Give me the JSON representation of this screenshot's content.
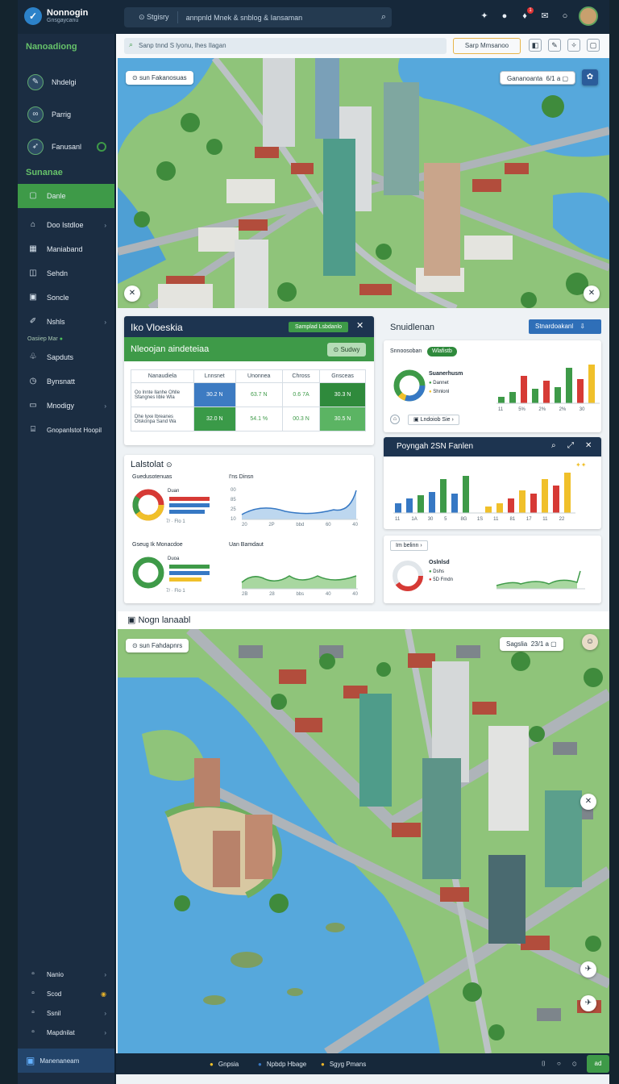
{
  "app": {
    "name": "Nonnogin",
    "subtitle": "Gnsgaycanu"
  },
  "search": {
    "scope": "Stgisry",
    "query": "annpnld Mnek & snblog & Iansaman"
  },
  "sidebar": {
    "section1": "Nanoadiong",
    "top_items": [
      {
        "label": "Nhdelgi",
        "icon": "leaf-icon"
      },
      {
        "label": "Parrig",
        "icon": "link-icon"
      },
      {
        "label": "Fanusanl",
        "icon": "plane-icon"
      }
    ],
    "section2": "Sunanae",
    "items": [
      {
        "label": "Danle",
        "icon": "square-icon"
      },
      {
        "label": "Doo Istdloe",
        "icon": "pin-icon"
      },
      {
        "label": "Maniaband",
        "icon": "grid-icon"
      },
      {
        "label": "Sehdn",
        "icon": "box-icon"
      },
      {
        "label": "Soncle",
        "icon": "frame-icon"
      },
      {
        "label": "Nshls",
        "icon": "pen-icon"
      }
    ],
    "status": "Oasiiep Mar",
    "items2": [
      {
        "label": "Sapduts",
        "icon": "bag-icon"
      },
      {
        "label": "Bynsnatt",
        "icon": "clock-icon"
      },
      {
        "label": "Mnodigy",
        "icon": "doc-icon"
      },
      {
        "label": "Gnopanlstot Hoopil",
        "icon": "building-icon"
      }
    ],
    "bottom_items": [
      "Nanio",
      "Scod",
      "Ssnil",
      "Mapdnilat"
    ],
    "brand": "Manenaneam"
  },
  "subbar": {
    "search": "Sanp tnnd S lyonu, lhes Ilagan",
    "button": "Sarp Mmsanoo"
  },
  "map_top": {
    "chip": "sun Fakanosuas",
    "chip_right": "Gananoanta",
    "chip_right_val": "6/1 a"
  },
  "panel_table": {
    "title": "Iko Vloeskia",
    "badge": "Samplad Lsbdanlo",
    "subtitle": "Nleoojan aindeteiaa",
    "button": "Sudwy",
    "headers": [
      "Nanaudiela",
      "Lnnsnet",
      "Unonnea",
      "Chross",
      "Gnsceas"
    ],
    "rows": [
      {
        "label": "Oo lnnte llanhe Ohlle\nSfangnes lible Wla",
        "values": [
          "30.2 N",
          "63.7 N",
          "0.6 7A",
          "30.3 N"
        ]
      },
      {
        "label": "Dhe lyxe lbreanes\nOlskonpa Sand Wa",
        "values": [
          "32.0 N",
          "54.1 %",
          "00.3 N",
          "30.5 N"
        ]
      }
    ]
  },
  "panel_right1": {
    "title": "Snuidlenan",
    "button": "Stnardoakanl",
    "card_label": "Snnoosoban",
    "card_tag": "Wlafistb",
    "legend_title": "Suanerhusm",
    "legend": [
      "Dannet",
      "Shnlonl"
    ],
    "button2": "Lndoiob Sie",
    "chart_labels": [
      "11",
      "5%",
      "2%",
      "2%",
      "30"
    ]
  },
  "panel_charts": {
    "title": "Lalstolat",
    "donut1_title": "Guedusotenuas",
    "donut1_sub": "Duan",
    "line1_title": "I'ns Dinsn",
    "line1_ticks": [
      "00",
      "85",
      "25",
      "10"
    ],
    "line1_x": [
      "20",
      "2P",
      "bbd",
      "60",
      "40"
    ],
    "donut2_title": "Gseug Ik Monacdoe",
    "donut2_sub": "Duoa",
    "line2_title": "Uan Bamdaut",
    "line2_x": [
      "2B",
      "28",
      "bbs",
      "40",
      "40"
    ],
    "donut_foot": "7/ · Flo 1"
  },
  "panel_dark": {
    "title": "Poyngah 2SN Fanlen",
    "chart_labels": [
      "11",
      "1A",
      "30",
      "5",
      "8G",
      "1S",
      "11",
      "81",
      "17",
      "11",
      "22"
    ]
  },
  "panel_small": {
    "chip": "Im belinn",
    "legend_title": "Oslnlsd",
    "legend": [
      "Dshs",
      "5D Fmdn"
    ]
  },
  "map_bottom": {
    "title": "Nogn lanaabl",
    "chip": "sun Fahdapnrs",
    "chip_right": "Sagslia",
    "chip_right_val": "23/1 a"
  },
  "bottombar": {
    "items": [
      "Gnpsia",
      "Npbdp Hbage",
      "Sgyg Pmans"
    ],
    "status": "ad"
  },
  "colors": {
    "green": "#3e9a48",
    "blue": "#3678c4",
    "red": "#d63a35",
    "yellow": "#f0c02a",
    "navy": "#1b2d42"
  }
}
